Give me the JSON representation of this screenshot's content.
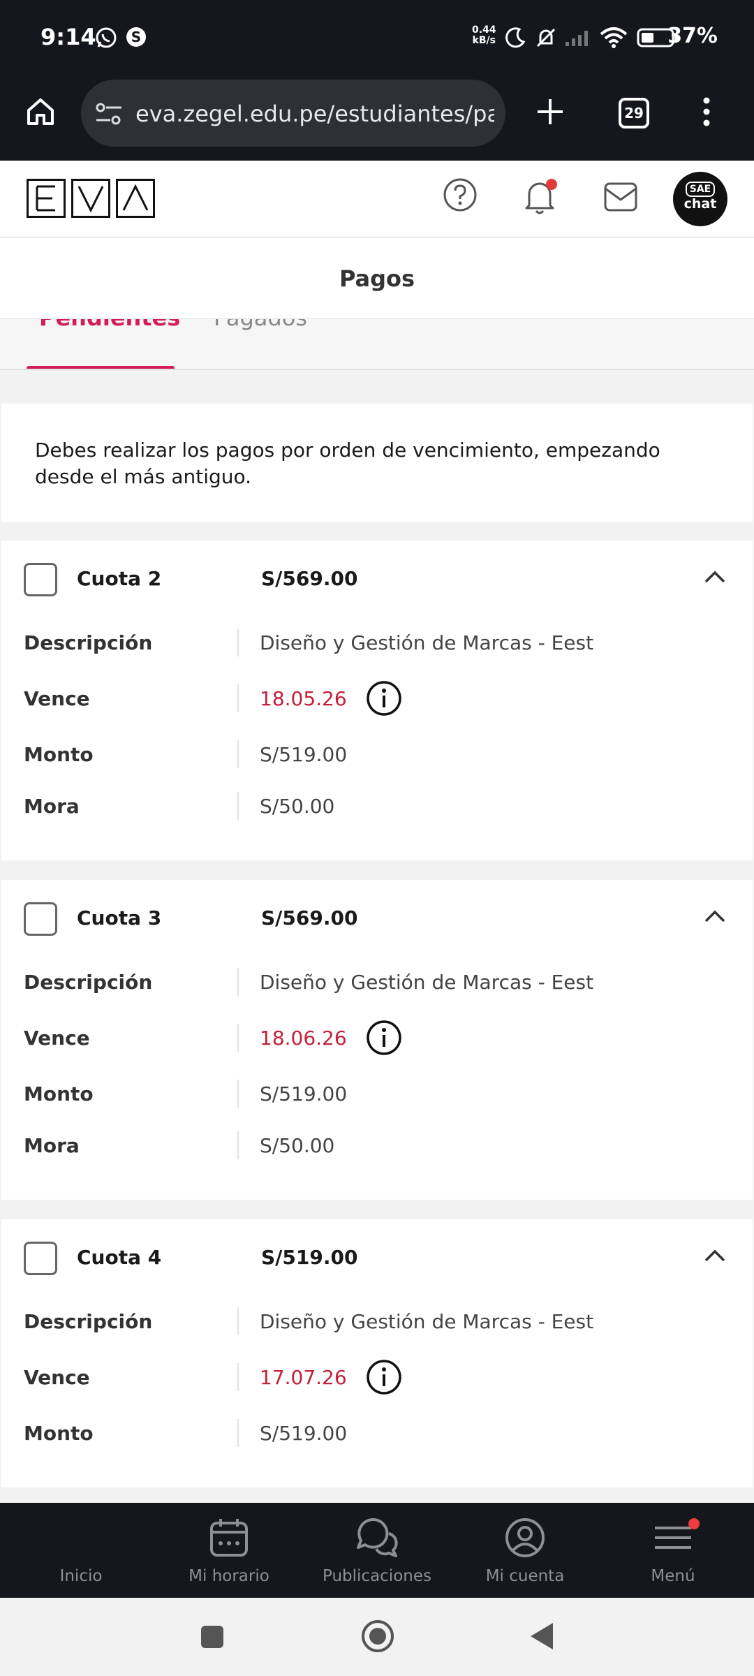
{
  "status_bar": {
    "time": "9:14",
    "net_speed_value": "0.44",
    "net_speed_unit": "kB/s",
    "battery": "37%"
  },
  "browser": {
    "url": "eva.zegel.edu.pe/estudiantes/pa",
    "tab_count": "29"
  },
  "header": {
    "logo_letters": [
      "E",
      "V",
      "Λ"
    ],
    "chat_badge_top": "SAE",
    "chat_badge_bottom": "chat"
  },
  "page_title": "Pagos",
  "tabs": [
    {
      "label": "Pendientes",
      "active": true
    },
    {
      "label": "Pagados",
      "active": false
    }
  ],
  "notice": "Debes realizar los pagos por orden de vencimiento, empezando desde el más antiguo.",
  "field_labels": {
    "descripcion": "Descripción",
    "vence": "Vence",
    "monto": "Monto",
    "mora": "Mora"
  },
  "cuotas": [
    {
      "label": "Cuota 2",
      "total": "S/569.00",
      "descripcion": "Diseño y Gestión de Marcas - Eest",
      "vence": "18.05.26",
      "monto": "S/519.00",
      "mora": "S/50.00"
    },
    {
      "label": "Cuota 3",
      "total": "S/569.00",
      "descripcion": "Diseño y Gestión de Marcas - Eest",
      "vence": "18.06.26",
      "monto": "S/519.00",
      "mora": "S/50.00"
    },
    {
      "label": "Cuota 4",
      "total": "S/519.00",
      "descripcion": "Diseño y Gestión de Marcas - Eest",
      "vence": "17.07.26",
      "monto": "S/519.00"
    }
  ],
  "bottom_nav": [
    {
      "label": "Inicio",
      "icon": "home-icon"
    },
    {
      "label": "Mi horario",
      "icon": "calendar-icon"
    },
    {
      "label": "Publicaciones",
      "icon": "chat-bubbles-icon"
    },
    {
      "label": "Mi cuenta",
      "icon": "account-icon"
    },
    {
      "label": "Menú",
      "icon": "menu-icon"
    }
  ],
  "colors": {
    "accent": "#d21d5a",
    "due_date": "#c3203a",
    "dark_bar": "#16171c"
  }
}
